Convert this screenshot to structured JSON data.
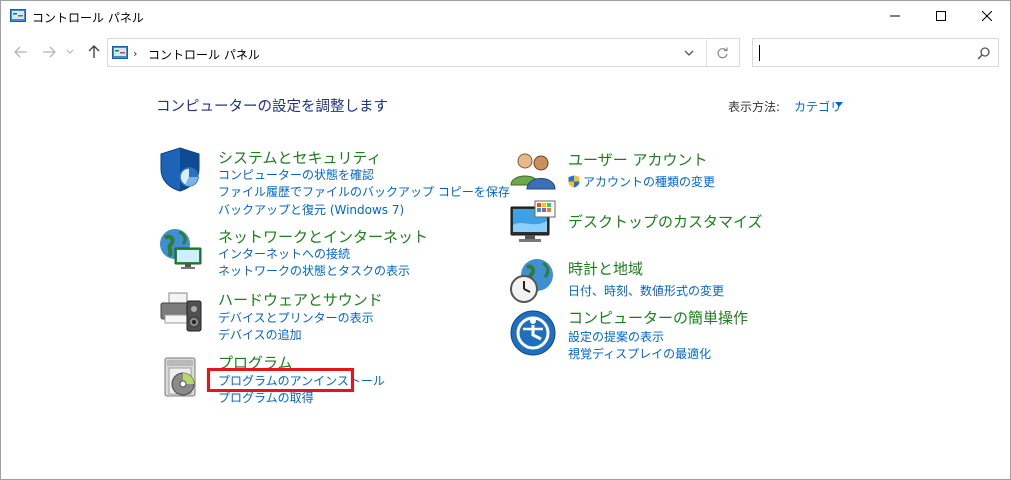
{
  "window": {
    "title": "コントロール パネル"
  },
  "address": {
    "path": "コントロール パネル",
    "chevron": "›"
  },
  "search": {
    "placeholder": ""
  },
  "content": {
    "page_title": "コンピューターの設定を調整します",
    "view_label": "表示方法:",
    "view_value": "カテゴリ"
  },
  "categories_left": [
    {
      "title": "システムとセキュリティ",
      "icon": "shield-icon",
      "links": [
        "コンピューターの状態を確認",
        "ファイル履歴でファイルのバックアップ コピーを保存",
        "バックアップと復元 (Windows 7)"
      ]
    },
    {
      "title": "ネットワークとインターネット",
      "icon": "network-globe-icon",
      "links": [
        "インターネットへの接続",
        "ネットワークの状態とタスクの表示"
      ]
    },
    {
      "title": "ハードウェアとサウンド",
      "icon": "printer-speaker-icon",
      "links": [
        "デバイスとプリンターの表示",
        "デバイスの追加"
      ]
    },
    {
      "title": "プログラム",
      "icon": "programs-disc-icon",
      "links": [
        "プログラムのアンインストール",
        "プログラムの取得"
      ]
    }
  ],
  "categories_right": [
    {
      "title": "ユーザー アカウント",
      "icon": "users-icon",
      "links": [
        "アカウントの種類の変更"
      ]
    },
    {
      "title": "デスクトップのカスタマイズ",
      "icon": "monitor-icon",
      "links": []
    },
    {
      "title": "時計と地域",
      "icon": "clock-globe-icon",
      "links": [
        "日付、時刻、数値形式の変更"
      ]
    },
    {
      "title": "コンピューターの簡単操作",
      "icon": "ease-of-access-icon",
      "links": [
        "設定の提案の表示",
        "視覚ディスプレイの最適化"
      ]
    }
  ],
  "colors": {
    "category_title": "#1a7f1a",
    "link": "#0066cc",
    "page_title": "#1e3287",
    "highlight": "#e8141b"
  }
}
